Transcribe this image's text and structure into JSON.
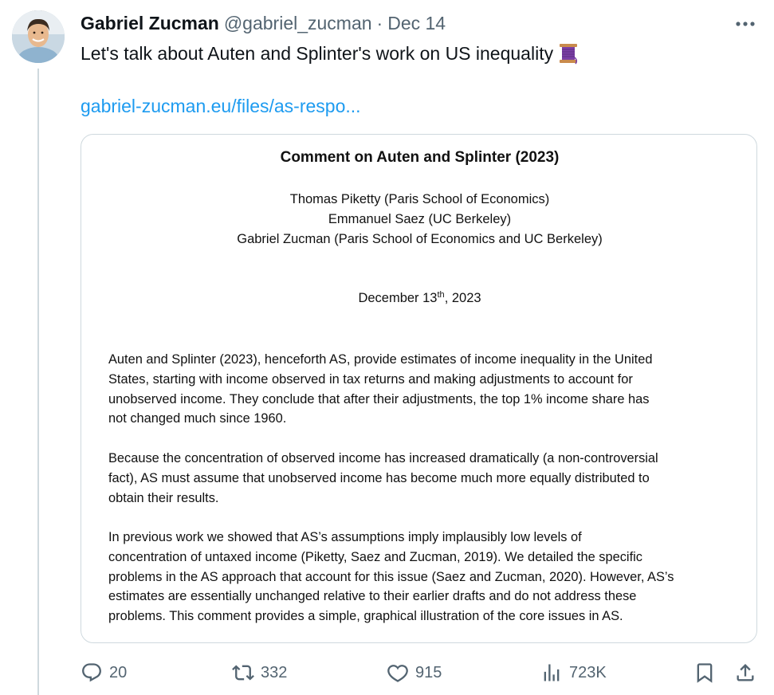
{
  "author": {
    "name": "Gabriel Zucman",
    "handle": "@gabriel_zucman",
    "separator": "·",
    "date": "Dec 14"
  },
  "tweet": {
    "text": "Let's talk about Auten and Splinter's work on US inequality",
    "emoji_icon": "thread-spool-icon",
    "link_text": "gabriel-zucman.eu/files/as-respo..."
  },
  "document": {
    "title": "Comment on Auten and Splinter (2023)",
    "authors": [
      "Thomas Piketty (Paris School of Economics)",
      "Emmanuel Saez (UC Berkeley)",
      "Gabriel Zucman (Paris School of Economics and UC Berkeley)"
    ],
    "date_prefix": "December 13",
    "date_sup": "th",
    "date_suffix": ", 2023",
    "paragraphs": [
      [
        "Auten and Splinter (2023), henceforth AS, provide estimates of income inequality in the United",
        "States, starting with income observed in tax returns and making adjustments to account for",
        "unobserved income. They conclude that after their adjustments, the top 1% income share has",
        "not changed much since 1960."
      ],
      [
        "Because the concentration of observed income has increased dramatically (a non-controversial",
        "fact), AS must assume that unobserved income has become much more equally distributed to",
        "obtain their results."
      ],
      [
        "In previous work we showed that AS’s assumptions imply implausibly low levels of",
        "concentration of untaxed income (Piketty, Saez and Zucman, 2019). We detailed the specific",
        "problems in the AS approach that account for this issue (Saez and Zucman, 2020). However, AS’s",
        "estimates are essentially unchanged relative to their earlier drafts and do not address these",
        "problems. This comment provides a simple, graphical illustration of the core issues in AS."
      ]
    ]
  },
  "actions": {
    "replies": "20",
    "reposts": "332",
    "likes": "915",
    "views": "723K"
  },
  "colors": {
    "text": "#0f1419",
    "muted": "#536471",
    "link": "#1d9bf0",
    "border": "#cfd9de"
  }
}
